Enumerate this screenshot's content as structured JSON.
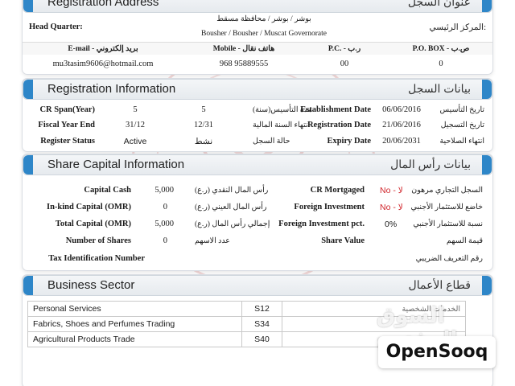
{
  "registration_address": {
    "title_en": "Registration Address",
    "title_ar": "عنوان السجل",
    "head_quarter_label": "Head Quarter:",
    "head_quarter_label_ar": "المركز الرئيسي:",
    "hq_value_ar": "بوشر / بوشر / محافظة مسقط",
    "hq_value_en": "Bousher / Bousher / Muscat Governorate",
    "columns": {
      "email": "E-mail - بريد إلكتروني",
      "mobile": "Mobile - هاتف نقال",
      "pc": "P.C. - ر.ب",
      "pobox": "P.O. BOX - ص.ب"
    },
    "values": {
      "email": "mu3tasim9606@hotmail.com",
      "mobile": "968 95889555",
      "pc": "00",
      "pobox": "0"
    }
  },
  "registration_info": {
    "title_en": "Registration Information",
    "title_ar": "بيانات السجل",
    "rows": [
      {
        "label_en": "CR Span(Year)",
        "val_en": "5",
        "val_ar": "5",
        "label_ar": "مدة التأسيس(سنة)",
        "label2_en": "Establishment Date",
        "val2": "06/06/2016",
        "label2_ar": "تاريخ التأسيس"
      },
      {
        "label_en": "Fiscal Year End",
        "val_en": "31/12",
        "val_ar": "12/31",
        "label_ar": "انتهاء السنة المالية",
        "label2_en": "Registration Date",
        "val2": "21/06/2016",
        "label2_ar": "تاريخ التسجيل"
      },
      {
        "label_en": "Register Status",
        "val_en": "Active",
        "val_ar": "نشط",
        "label_ar": "حالة السجل",
        "label2_en": "Expiry Date",
        "val2": "20/06/2031",
        "label2_ar": "انتهاء الصلاحية"
      }
    ]
  },
  "share_capital": {
    "title_en": "Share Capital Information",
    "title_ar": "بيانات رأس المال",
    "rows": [
      {
        "label_en": "Capital Cash",
        "val": "5,000",
        "label_ar": "رأس المال النقدي (ر.ع)",
        "label2_en": "CR Mortgaged",
        "val2": "No - لا",
        "label2_ar": "السجل التجاري مرهون"
      },
      {
        "label_en": "In-kind Capital (OMR)",
        "val": "0",
        "label_ar": "رأس المال العيني (ر.ع)",
        "label2_en": "Foreign Investment",
        "val2": "No - لا",
        "label2_ar": "خاضع للاستثمار الأجنبي"
      },
      {
        "label_en": "Total Capital (OMR)",
        "val": "5,000",
        "label_ar": "إجمالي رأس المال (ر.ع)",
        "label2_en": "Foreign Investment pct.",
        "val2": "0%",
        "label2_ar": "نسبة للاستثمار الأجنبي"
      },
      {
        "label_en": "Number of Shares",
        "val": "0",
        "label_ar": "عدد الاسهم",
        "label2_en": "Share Value",
        "val2": "",
        "label2_ar": "قيمة السهم"
      },
      {
        "label_en": "Tax Identification Number",
        "val": "",
        "label_ar": "",
        "label2_en": "",
        "val2": "",
        "label2_ar": "رقم التعريف الضريبي"
      }
    ]
  },
  "business_sector": {
    "title_en": "Business Sector",
    "title_ar": "قطاع الأعمال",
    "rows": [
      {
        "desc": "Personal Services",
        "code": "S12",
        "desc_ar": "الخدمات الشخصية"
      },
      {
        "desc": "Fabrics, Shoes and Perfumes Trading",
        "code": "S34",
        "desc_ar": ""
      },
      {
        "desc": "Agricultural Products Trade",
        "code": "S40",
        "desc_ar": ""
      }
    ]
  },
  "watermark": {
    "arabic_text": "السوق المفتوح",
    "brand": "OpenSooq"
  },
  "colors": {
    "accent_blue": "#2e86c8",
    "red_value": "#d0242a"
  }
}
